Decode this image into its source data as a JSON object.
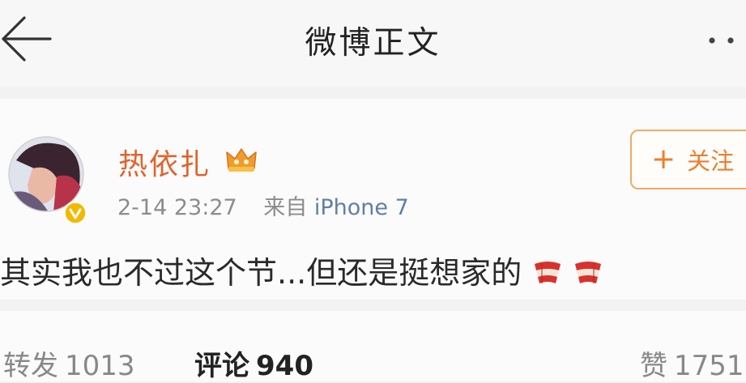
{
  "header": {
    "title": "微博正文"
  },
  "post": {
    "username": "热依扎",
    "time": "2-14 23:27",
    "source_prefix": "来自",
    "source_device": "iPhone 7",
    "text": "其实我也不过这个节...但还是挺想家的",
    "follow_label": "关注",
    "follow_plus": "+"
  },
  "tabs": {
    "repost_label": "转发",
    "repost_count": "1013",
    "comments_label": "评论",
    "comments_count": "940",
    "likes_label": "赞",
    "likes_count": "1751"
  },
  "colors": {
    "username": "#e2622a",
    "follow_accent": "#ee7d2b",
    "device_link": "#607fa6",
    "verified_badge": "#f5b800"
  },
  "icons": {
    "back": "arrow-left-icon",
    "more": "more-dots-icon",
    "vip": "crown-vip-icon",
    "verified": "verified-v-icon",
    "emoji": "scarf-emoji-icon"
  }
}
